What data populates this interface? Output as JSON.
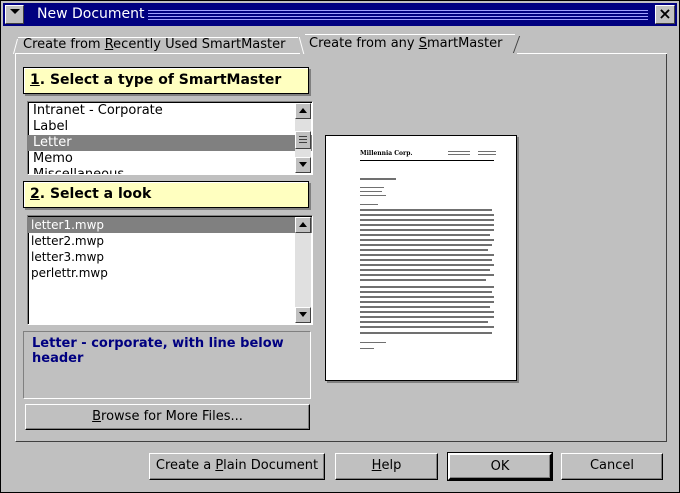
{
  "window": {
    "title": "New Document",
    "close_label": "×"
  },
  "tabs": [
    {
      "pre": "Create from ",
      "key": "R",
      "post": "ecently Used SmartMaster",
      "active": false
    },
    {
      "pre": "Create from any ",
      "key": "S",
      "post": "martMaster",
      "active": true
    }
  ],
  "section1": {
    "key": "1",
    "label": ". Select a type of SmartMaster"
  },
  "types": [
    "Intranet - Corporate",
    "Label",
    "Letter",
    "Memo",
    "Miscellaneous"
  ],
  "selected_type": "Letter",
  "section2": {
    "key": "2",
    "label": ". Select a look"
  },
  "looks": [
    "letter1.mwp",
    "letter2.mwp",
    "letter3.mwp",
    "perlettr.mwp"
  ],
  "selected_look": "letter1.mwp",
  "description": "Letter - corporate, with line below header",
  "browse_button": {
    "key": "B",
    "rest": "rowse for More Files..."
  },
  "buttons": {
    "plain": {
      "pre": "Create a ",
      "key": "P",
      "post": "lain Document"
    },
    "help": {
      "key": "H",
      "post": "elp"
    },
    "ok": "OK",
    "cancel": "Cancel"
  },
  "preview": {
    "company": "Millennia Corp."
  }
}
